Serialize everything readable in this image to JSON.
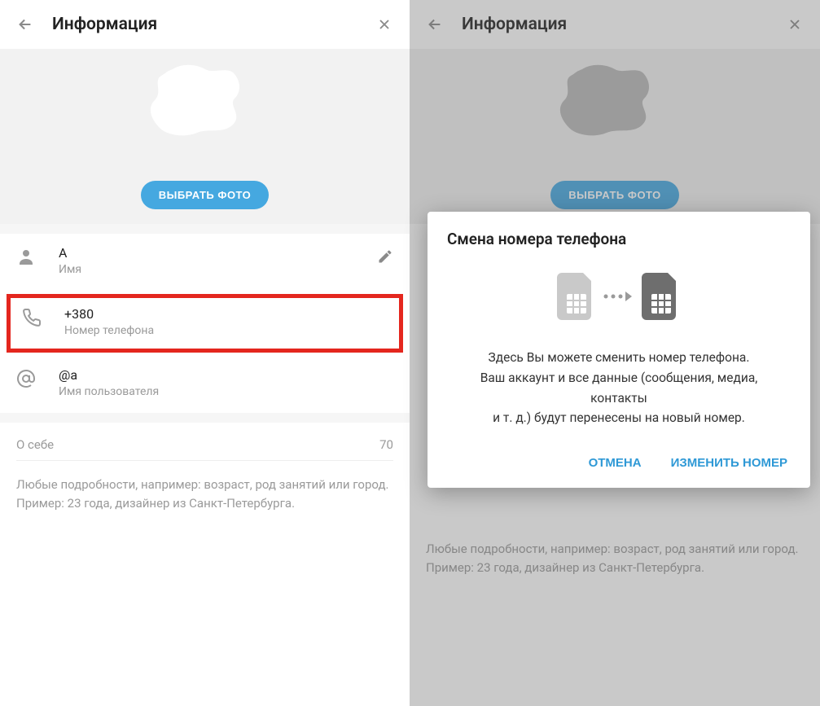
{
  "left": {
    "header": {
      "title": "Информация"
    },
    "photo": {
      "button": "ВЫБРАТЬ ФОТО"
    },
    "name_row": {
      "value": "A",
      "label": "Имя"
    },
    "phone_row": {
      "value": "+380",
      "label": "Номер телефона"
    },
    "username_row": {
      "value": "@a",
      "label": "Имя пользователя"
    },
    "about": {
      "label": "О себе",
      "counter": "70",
      "hint_line1": "Любые подробности, например: возраст, род занятий или город.",
      "hint_line2": "Пример: 23 года, дизайнер из Санкт-Петербурга."
    }
  },
  "right": {
    "header": {
      "title": "Информация"
    },
    "photo": {
      "button": "ВЫБРАТЬ ФОТО"
    },
    "about": {
      "hint_line1": "Любые подробности, например: возраст, род занятий или город.",
      "hint_line2": "Пример: 23 года, дизайнер из Санкт-Петербурга."
    },
    "modal": {
      "title": "Смена номера телефона",
      "desc_line1": "Здесь Вы можете сменить номер телефона.",
      "desc_line2": "Ваш аккаунт и все данные (сообщения, медиа, контакты",
      "desc_line3": "и т. д.) будут перенесены на новый номер.",
      "cancel": "ОТМЕНА",
      "confirm": "ИЗМЕНИТЬ НОМЕР"
    }
  },
  "colors": {
    "accent": "#45a8e0",
    "highlight": "#e4261e",
    "modal_action": "#2f99d6"
  }
}
